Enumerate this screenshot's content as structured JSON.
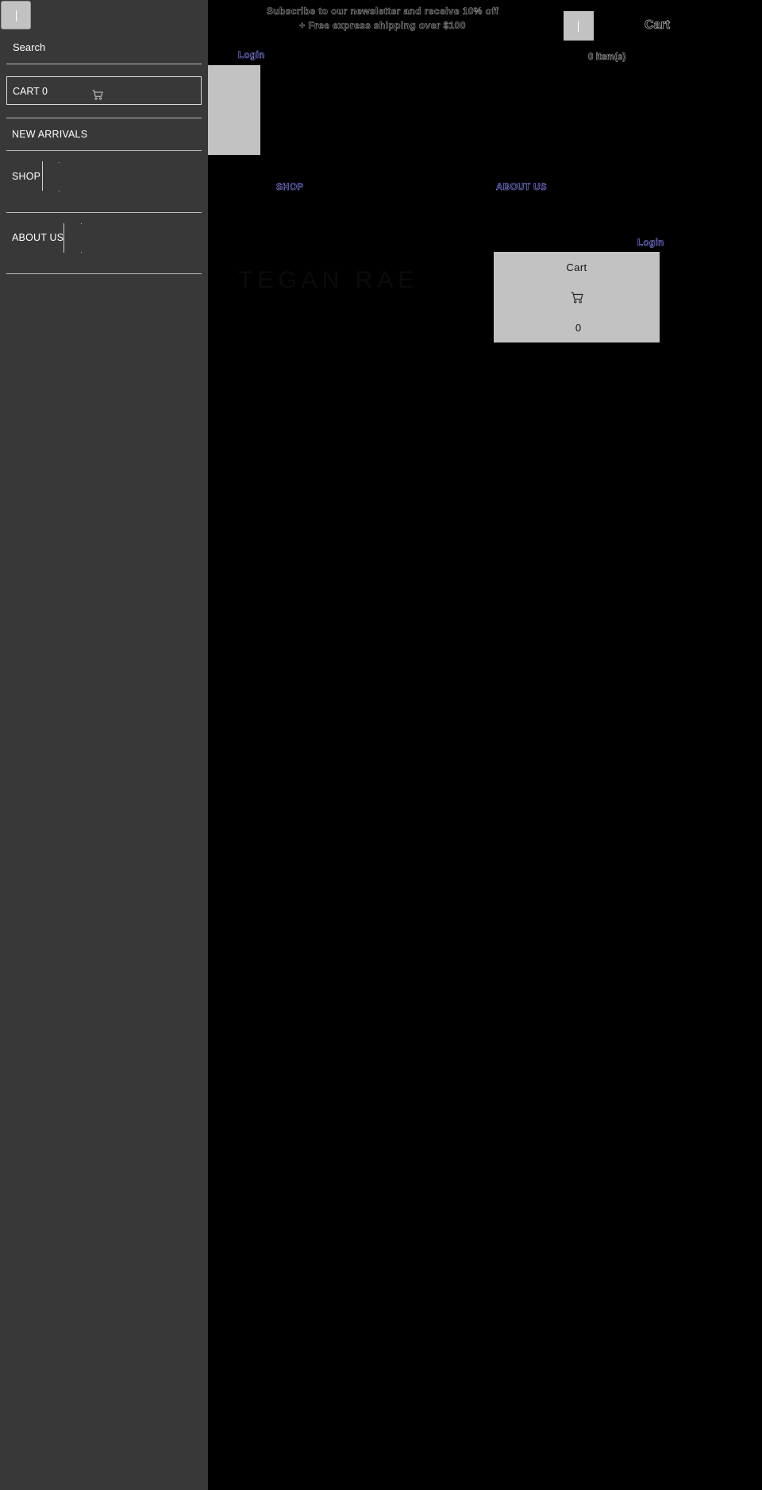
{
  "promo": {
    "line1": "Subscribe to our newsletter and receive 10% off",
    "line2": "+ Free express shipping over $100"
  },
  "header": {
    "cart_label": "Cart",
    "items_label": "0 item(s)",
    "login_label": "Login"
  },
  "nav": {
    "shop_label": "SHOP",
    "about_label": "ABOUT US"
  },
  "brand": {
    "name": "TEGAN RAE"
  },
  "cart_panel": {
    "login_label": "Login",
    "title": "Cart",
    "count": "0",
    "icon": "cart-icon"
  },
  "sidebar": {
    "search_label": "Search",
    "cart_label": "CART 0",
    "cart_icon": "cart-icon",
    "items": [
      {
        "label": "NEW ARRIVALS"
      },
      {
        "label": "SHOP"
      },
      {
        "label": "ABOUT US"
      }
    ]
  },
  "colors": {
    "background": "#000000",
    "sidebar": "#383838",
    "placeholder": "#c2c2c2",
    "link": "#8b8bff"
  }
}
